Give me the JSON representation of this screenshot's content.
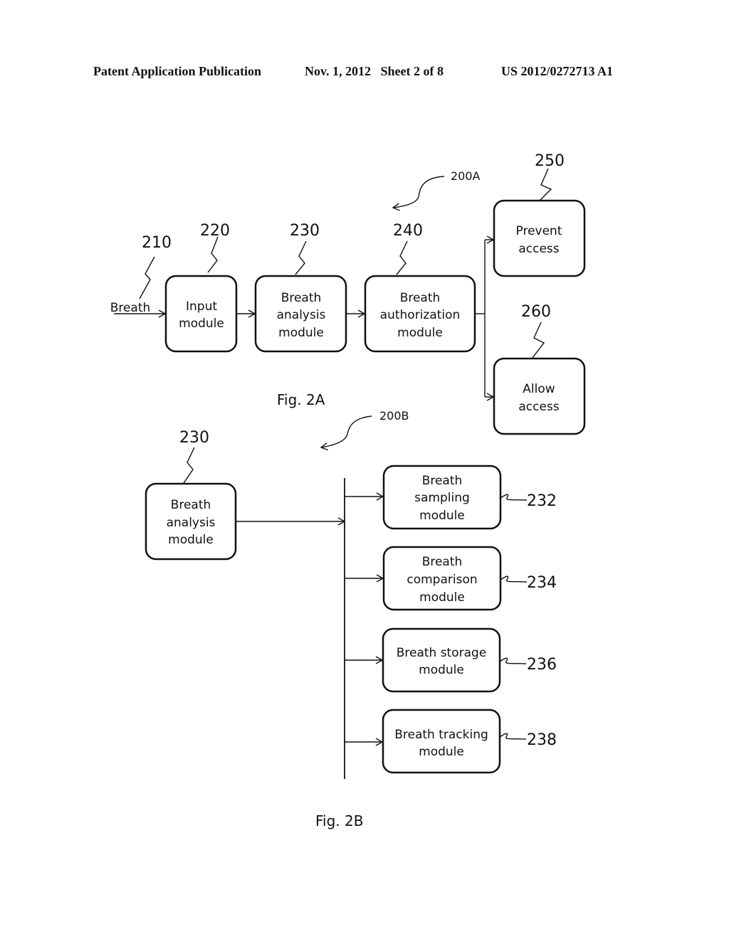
{
  "header": {
    "publication": "Patent Application Publication",
    "date_sheet": "Nov. 1, 2012   Sheet 2 of 8",
    "patent_number": "US 2012/0272713 A1"
  },
  "fig2a": {
    "ref": "200A",
    "caption": "Fig. 2A",
    "input_label": "Breath",
    "input_ref": "210",
    "boxes": [
      {
        "ref": "220",
        "lines": [
          "Input",
          "module"
        ]
      },
      {
        "ref": "230",
        "lines": [
          "Breath",
          "analysis",
          "module"
        ]
      },
      {
        "ref": "240",
        "lines": [
          "Breath",
          "authorization",
          "module"
        ]
      },
      {
        "ref": "250",
        "lines": [
          "Prevent",
          "access"
        ]
      },
      {
        "ref": "260",
        "lines": [
          "Allow",
          "access"
        ]
      }
    ]
  },
  "fig2b": {
    "ref": "200B",
    "caption": "Fig. 2B",
    "source": {
      "ref": "230",
      "lines": [
        "Breath",
        "analysis",
        "module"
      ]
    },
    "submodules": [
      {
        "ref": "232",
        "lines": [
          "Breath",
          "sampling",
          "module"
        ]
      },
      {
        "ref": "234",
        "lines": [
          "Breath",
          "comparison",
          "module"
        ]
      },
      {
        "ref": "236",
        "lines": [
          "Breath storage",
          "module"
        ]
      },
      {
        "ref": "238",
        "lines": [
          "Breath tracking",
          "module"
        ]
      }
    ]
  }
}
